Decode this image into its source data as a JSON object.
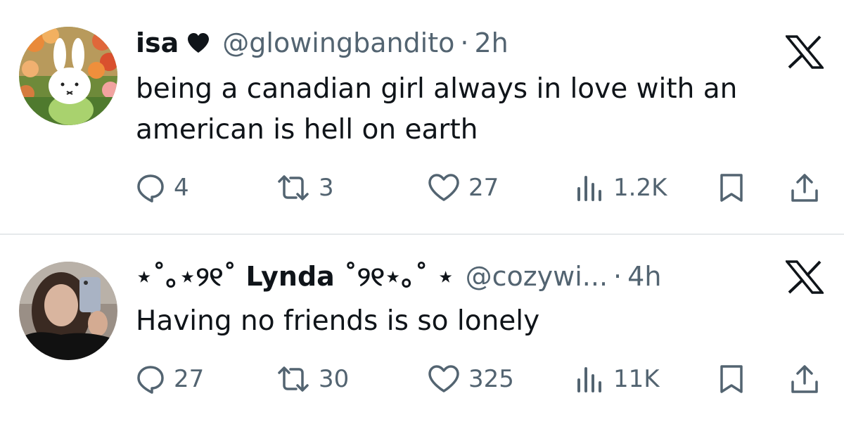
{
  "tweets": [
    {
      "display_name": "isa",
      "badge_icon": "black-heart-icon",
      "handle": "@glowingbandito",
      "separator": "·",
      "time": "2h",
      "lines": [
        "being a canadian girl always in love with an",
        "american is hell on earth"
      ],
      "replies": "4",
      "reposts": "3",
      "likes": "27",
      "views": "1.2K",
      "avatar": "miffy-bunny-tulips-avatar"
    },
    {
      "display_name": "⋆˚｡⋆୨୧˚ Lynda ˚୨୧⋆｡˚ ⋆",
      "handle": "@cozywi...",
      "separator": "·",
      "time": "4h",
      "lines": [
        "Having no friends is so lonely"
      ],
      "replies": "27",
      "reposts": "30",
      "likes": "325",
      "views": "11K",
      "avatar": "mirror-selfie-avatar"
    }
  ],
  "colors": {
    "text": "#0f1419",
    "secondary": "#536471",
    "divider": "#e6e9eb",
    "background": "#ffffff"
  },
  "icons": [
    "reply-icon",
    "repost-icon",
    "like-icon",
    "views-icon",
    "bookmark-icon",
    "share-icon",
    "x-logo-icon"
  ]
}
